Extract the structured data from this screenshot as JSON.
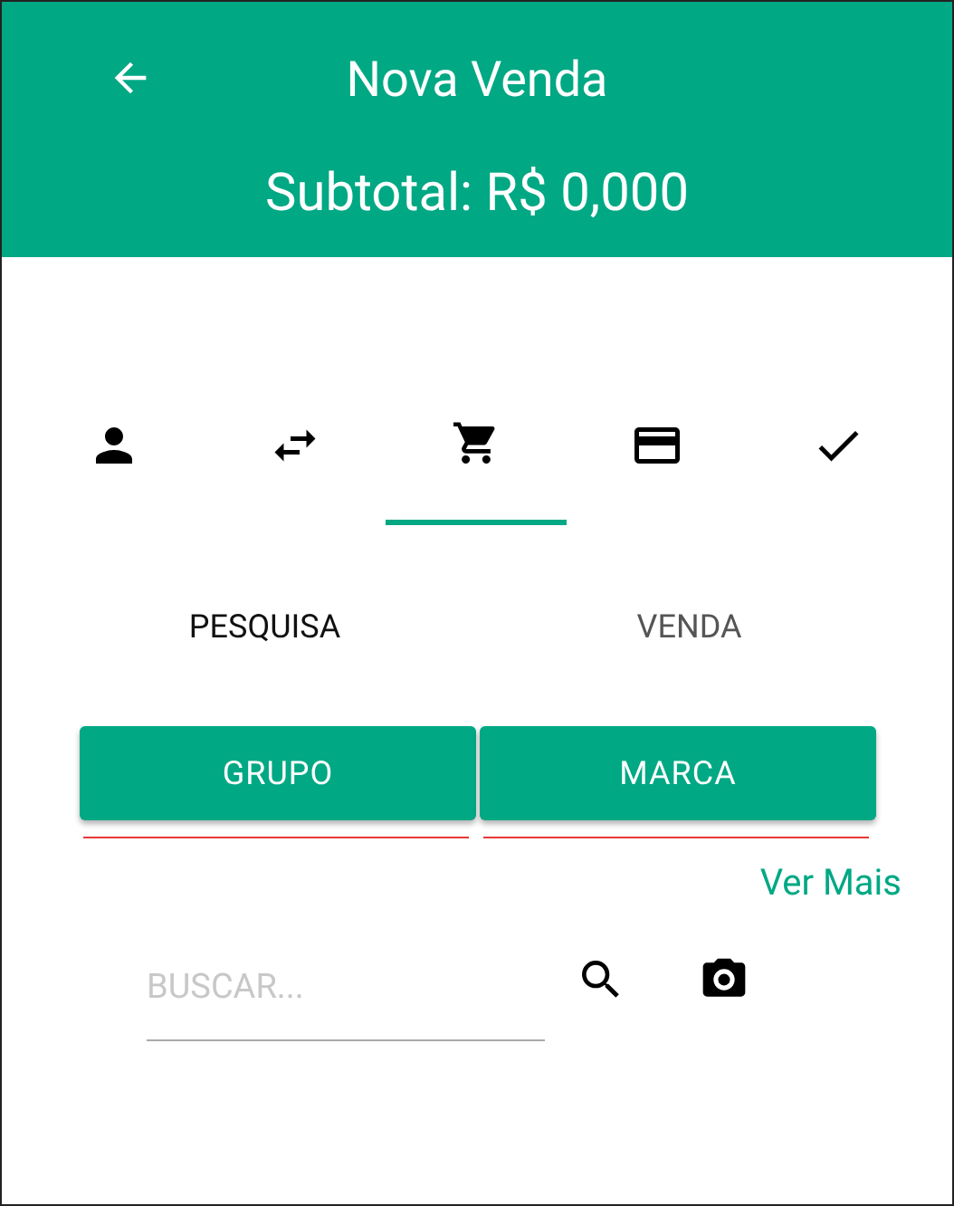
{
  "app_bar": {
    "title": "Nova Venda",
    "subtotal": "Subtotal: R$ 0,000"
  },
  "steps": [
    {
      "kind": "person",
      "selected": false
    },
    {
      "kind": "swap",
      "selected": false
    },
    {
      "kind": "cart",
      "selected": true
    },
    {
      "kind": "card",
      "selected": false
    },
    {
      "kind": "check",
      "selected": false
    }
  ],
  "tabs": [
    {
      "label": "PESQUISA",
      "selected": true
    },
    {
      "label": "VENDA",
      "selected": false
    }
  ],
  "filters": [
    {
      "label": "GRUPO"
    },
    {
      "label": "MARCA"
    }
  ],
  "more_link": "Ver Mais",
  "search": {
    "placeholder": "BUSCAR..."
  }
}
